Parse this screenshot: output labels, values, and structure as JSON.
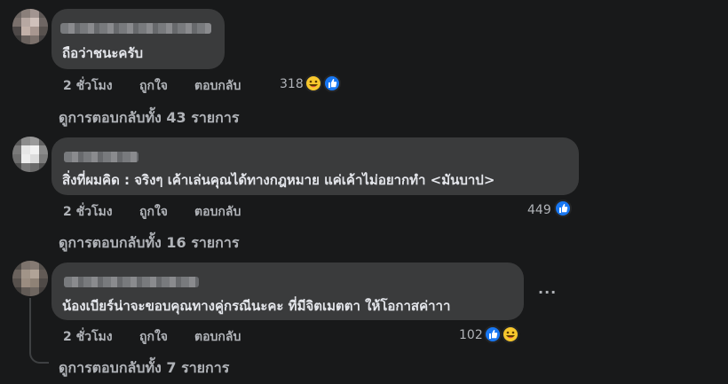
{
  "comments": [
    {
      "text": "ถือว่าชนะครับ",
      "time": "2 ชั่วโมง",
      "like_label": "ถูกใจ",
      "reply_label": "ตอบกลับ",
      "reaction_count": "318",
      "reactions": [
        "haha-icon",
        "like-icon"
      ],
      "view_replies": "ดูการตอบกลับทั้ง 43 รายการ"
    },
    {
      "text": "สิ่งที่ผมคิด : จริงๆ เค้าเล่นคุณได้ทางกฎหมาย แค่เค้าไม่อยากทำ <มันบาป>",
      "time": "2 ชั่วโมง",
      "like_label": "ถูกใจ",
      "reply_label": "ตอบกลับ",
      "reaction_count": "449",
      "reactions": [
        "like-icon"
      ],
      "view_replies": "ดูการตอบกลับทั้ง 16 รายการ"
    },
    {
      "text": "น้องเบียร์น่าจะขอบคุณทางคู่กรณีนะคะ ที่มีจิตเมตตา ให้โอกาสค่าาา",
      "time": "2 ชั่วโมง",
      "like_label": "ถูกใจ",
      "reply_label": "ตอบกลับ",
      "reaction_count": "102",
      "reactions": [
        "like-icon",
        "haha-icon"
      ],
      "view_replies": "ดูการตอบกลับทั้ง 7 รายการ",
      "more_label": "···"
    }
  ],
  "colors": {
    "background": "#18191a",
    "bubble": "#3a3b3c",
    "text": "#e4e6eb",
    "secondary": "#b0b3b8",
    "like_blue": "#1877f2",
    "haha_yellow": "#f7c72d"
  }
}
